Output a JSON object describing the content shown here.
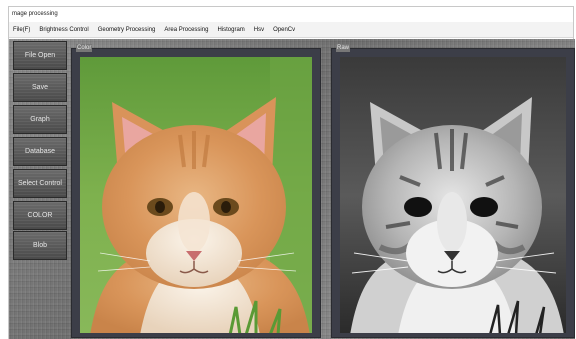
{
  "window": {
    "title": "mage processing"
  },
  "menu": [
    "File(F)",
    "Brightness Control",
    "Geometry Processing",
    "Area Processing",
    "Histogram",
    "Hsv",
    "OpenCv"
  ],
  "sidebar": {
    "buttons": [
      "File Open",
      "Save",
      "Graph",
      "Database",
      "Select Control",
      "COLOR",
      "Blob"
    ]
  },
  "panels": {
    "color": {
      "label": "Color"
    },
    "raw": {
      "label": "Raw"
    }
  },
  "colors": {
    "panel_bg": "#3c3e48",
    "button_bg": "#555555",
    "menu_bg": "#f3f3f3"
  }
}
